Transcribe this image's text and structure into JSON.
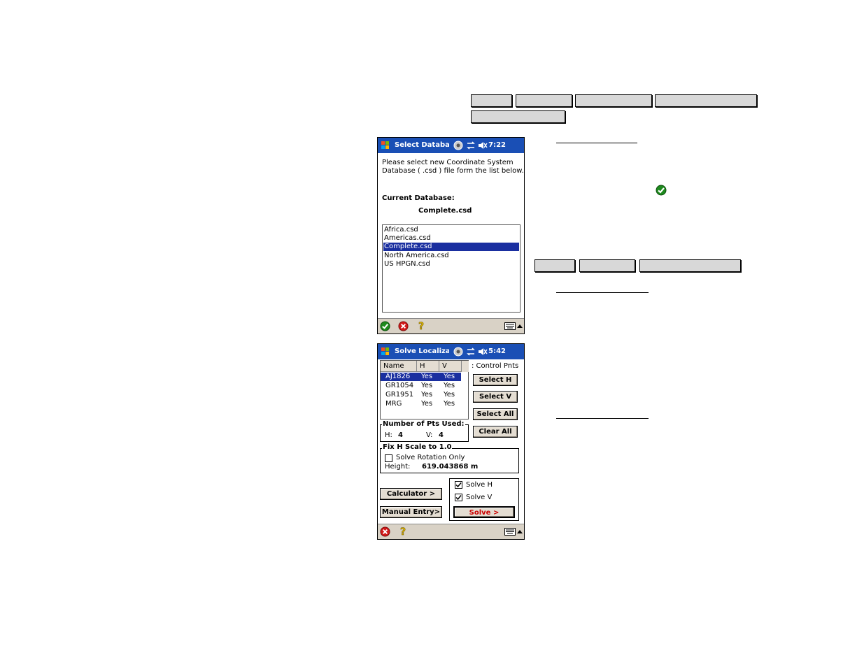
{
  "screen1": {
    "title": "Select Databas",
    "time": "7:22",
    "instructions_line1": "Please select new Coordinate System",
    "instructions_line2": "Database ( .csd ) file form the list below.",
    "current_label": "Current Database:",
    "current_value": "Complete.csd",
    "files": [
      "Africa.csd",
      "Americas.csd",
      "Complete.csd",
      "North America.csd",
      "US HPGN.csd"
    ],
    "selected_index": 2
  },
  "screen2": {
    "title": "Solve Localizati",
    "time": "5:42",
    "columns": [
      "Name",
      "H",
      "V"
    ],
    "rows": [
      {
        "name": "AJ1826",
        "h": "Yes",
        "v": "Yes"
      },
      {
        "name": "GR1054",
        "h": "Yes",
        "v": "Yes"
      },
      {
        "name": "GR1951",
        "h": "Yes",
        "v": "Yes"
      },
      {
        "name": "MRG",
        "h": "Yes",
        "v": "Yes"
      }
    ],
    "control_label": ": Control Pnts",
    "select_h": "Select H",
    "select_v": "Select V",
    "select_all": "Select All",
    "clear_all": "Clear All",
    "pts_used_label": "Number of Pts Used:",
    "h_label": "H:",
    "h_value": "4",
    "v_label": "V:",
    "v_value": "4",
    "fix_scale_label": "Fix H Scale to 1.0",
    "rotation_only": "Solve Rotation Only",
    "height_label": "Height:",
    "height_value": "619.043868 m",
    "calculator": "Calculator >",
    "manual_entry": "Manual Entry>",
    "solve_h": "Solve H",
    "solve_v": "Solve V",
    "solve": "Solve >"
  },
  "colors": {
    "titlebar": "#1a4fb5",
    "selection": "#1a2fa0",
    "bar": "#d9d2c6",
    "solve_text": "#cc0000"
  }
}
